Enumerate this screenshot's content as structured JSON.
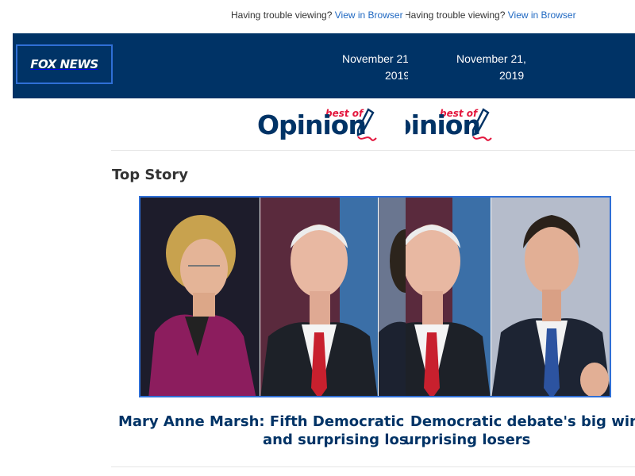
{
  "topbar": {
    "prompt": "Having trouble viewing?",
    "link": "View in Browser"
  },
  "header": {
    "logo": "FOX NEWS",
    "date_line1": "November 21,",
    "date_line2": "2019"
  },
  "opinion": {
    "bestof": "best of",
    "word": "Opinion"
  },
  "top_story": {
    "section_title": "Top Story",
    "headline_line1": "Mary Anne Marsh: Fifth Democratic debate's big winners",
    "headline_line2": "and surprising losers"
  },
  "colors": {
    "navy": "#003366",
    "link": "#2069c2",
    "accent_red": "#e3173e",
    "border_blue": "#2f6fd6"
  },
  "icons": [
    "pen-icon"
  ]
}
